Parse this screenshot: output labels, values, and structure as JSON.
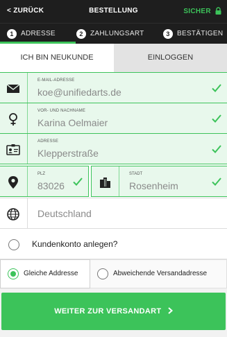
{
  "header": {
    "back_label": "< ZURÜCK",
    "title": "BESTELLUNG",
    "secure_label": "SICHER",
    "accent": "#3cc35a",
    "background": "#1e1e1e"
  },
  "steps": [
    {
      "num": "1",
      "label": "ADRESSE"
    },
    {
      "num": "2",
      "label": "ZAHLUNGSART"
    },
    {
      "num": "3",
      "label": "BESTÄTIGEN"
    }
  ],
  "tabs": {
    "new_customer": "ICH BIN NEUKUNDE",
    "login": "EINLOGGEN"
  },
  "form": {
    "email": {
      "caption": "E-MAIL-ADRESSE",
      "value": "koe@unifiedarts.de",
      "icon": "envelope-icon"
    },
    "name": {
      "caption": "VOR- UND NACHNAME",
      "value": "Karina Oelmaier",
      "icon": "female-icon"
    },
    "address": {
      "caption": "ADRESSE",
      "value": "Klepperstraße",
      "icon": "id-card-icon"
    },
    "zip": {
      "caption": "PLZ",
      "value": "83026",
      "icon": "map-pin-icon"
    },
    "city": {
      "caption": "STADT",
      "value": "Rosenheim",
      "icon": "buildings-icon"
    },
    "country": {
      "value": "Deutschland",
      "icon": "globe-icon"
    }
  },
  "account": {
    "label": "Kundenkonto anlegen?"
  },
  "shipping": {
    "same": "Gleiche Addresse",
    "different": "Abweichende Versandadresse"
  },
  "submit_label": "WEITER ZUR VERSANDART"
}
